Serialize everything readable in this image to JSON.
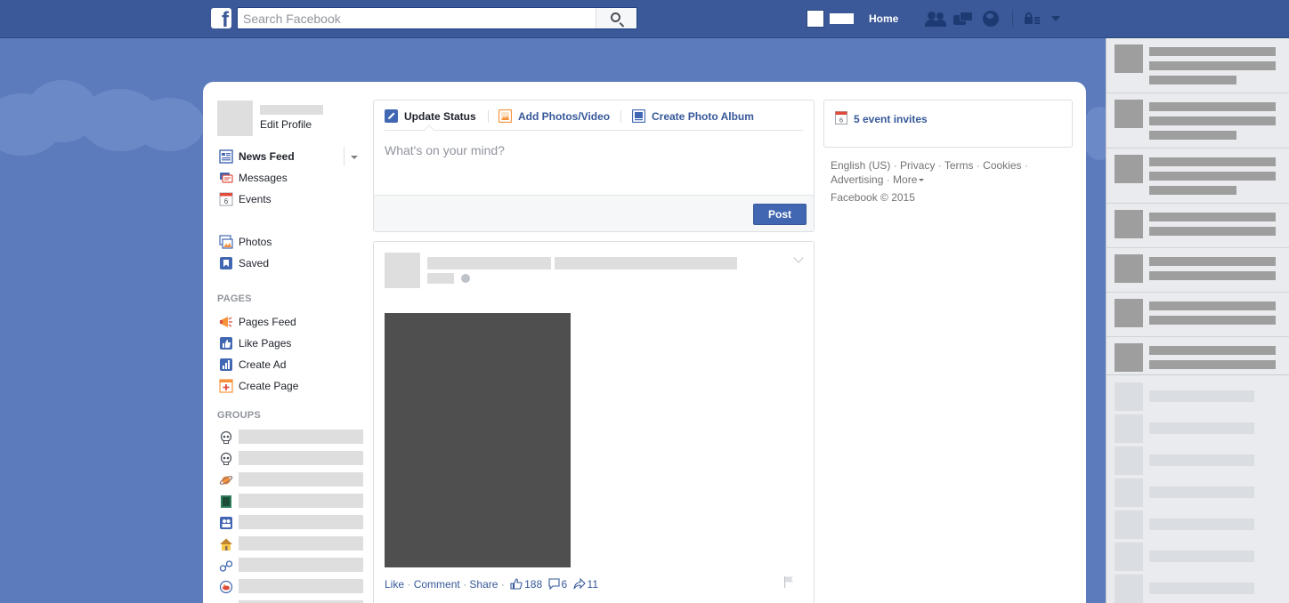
{
  "topbar": {
    "logo_letter": "f",
    "search_placeholder": "Search Facebook",
    "home_label": "Home"
  },
  "left_nav": {
    "edit_profile": "Edit Profile",
    "items": [
      {
        "label": "News Feed",
        "icon": "news-feed-icon"
      },
      {
        "label": "Messages",
        "icon": "messages-icon"
      },
      {
        "label": "Events",
        "icon": "events-icon"
      },
      {
        "label": "Photos",
        "icon": "photos-icon"
      },
      {
        "label": "Saved",
        "icon": "saved-icon"
      }
    ],
    "events_icon_number": "6",
    "pages_heading": "PAGES",
    "pages_items": [
      {
        "label": "Pages Feed",
        "icon": "pages-feed-icon"
      },
      {
        "label": "Like Pages",
        "icon": "like-pages-icon"
      },
      {
        "label": "Create Ad",
        "icon": "create-ad-icon"
      },
      {
        "label": "Create Page",
        "icon": "create-page-icon"
      }
    ],
    "groups_heading": "GROUPS",
    "group_icons": [
      "skull-icon",
      "skull-icon",
      "planet-icon",
      "book-icon",
      "people-icon",
      "house-icon",
      "glasses-icon",
      "fish-icon"
    ]
  },
  "composer": {
    "tabs": [
      "Update Status",
      "Add Photos/Video",
      "Create Photo Album"
    ],
    "placeholder": "What's on your mind?",
    "post_label": "Post"
  },
  "story": {
    "actions": {
      "like": "Like",
      "comment": "Comment",
      "share": "Share",
      "likes_count": "188",
      "comments_count": "6",
      "shares_count": "11"
    }
  },
  "right_col": {
    "event_icon_number": "6",
    "event_invites": "5 event invites",
    "footer_links": [
      "English (US)",
      "Privacy",
      "Terms",
      "Cookies",
      "Advertising",
      "More"
    ],
    "copyright": "Facebook © 2015"
  },
  "colors": {
    "brand": "#3b5998",
    "link": "#365899",
    "post_button": "#4267b2",
    "page_bg": "#5b7bbd"
  }
}
